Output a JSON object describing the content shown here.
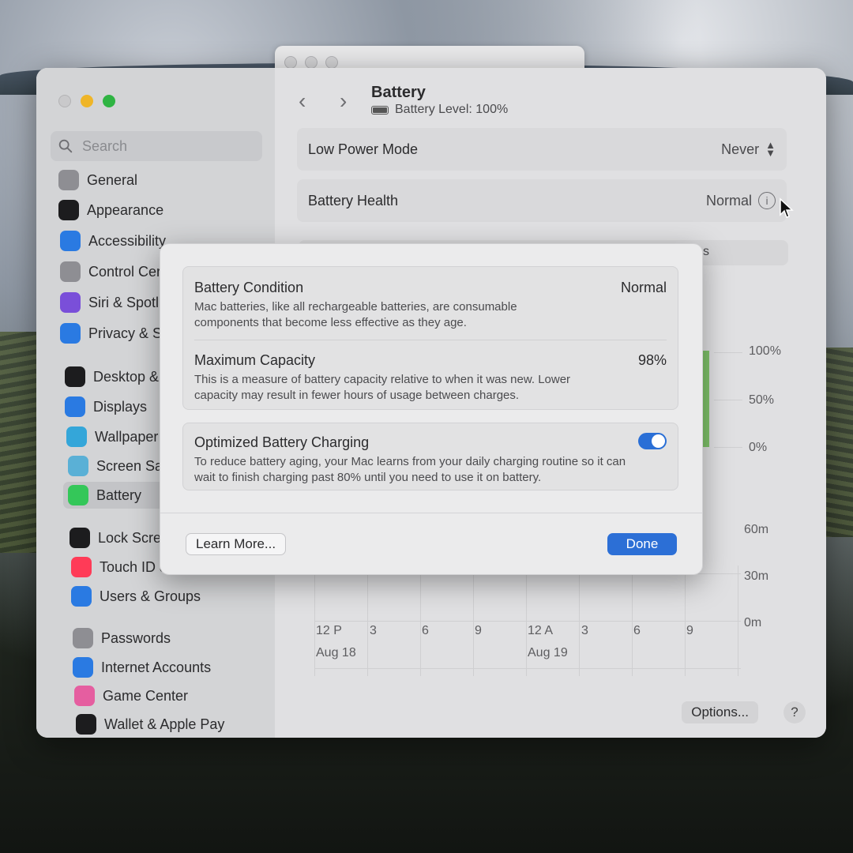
{
  "sidebar": {
    "search_placeholder": "Search",
    "items": [
      {
        "label": "General",
        "icon": "gear-icon",
        "color": "#8e8e93"
      },
      {
        "label": "Appearance",
        "icon": "appearance-icon",
        "color": "#1c1c1e"
      },
      {
        "label": "Accessibility",
        "icon": "accessibility-icon",
        "color": "#2a7ae2"
      },
      {
        "label": "Control Cer",
        "icon": "control-center-icon",
        "color": "#8e8e93"
      },
      {
        "label": "Siri & Spotl",
        "icon": "siri-icon",
        "color": "#7a4fd9"
      },
      {
        "label": "Privacy & S",
        "icon": "privacy-hand-icon",
        "color": "#2a7ae2"
      },
      {
        "label": "Desktop &",
        "icon": "desktop-dock-icon",
        "color": "#1c1c1e"
      },
      {
        "label": "Displays",
        "icon": "displays-icon",
        "color": "#2a7ae2"
      },
      {
        "label": "Wallpaper",
        "icon": "wallpaper-icon",
        "color": "#34a6d9"
      },
      {
        "label": "Screen Sav",
        "icon": "screen-saver-icon",
        "color": "#5ab0d6"
      },
      {
        "label": "Battery",
        "icon": "battery-icon",
        "color": "#34c759"
      },
      {
        "label": "Lock Scree",
        "icon": "lock-icon",
        "color": "#1c1c1e"
      },
      {
        "label": "Touch ID &",
        "icon": "fingerprint-icon",
        "color": "#ff3b57"
      },
      {
        "label": "Users & Groups",
        "icon": "users-icon",
        "color": "#2a7ae2"
      },
      {
        "label": "Passwords",
        "icon": "key-icon",
        "color": "#8e8e93"
      },
      {
        "label": "Internet Accounts",
        "icon": "at-sign-icon",
        "color": "#2a7ae2"
      },
      {
        "label": "Game Center",
        "icon": "game-center-icon",
        "color": "#e55ea0"
      },
      {
        "label": "Wallet & Apple Pay",
        "icon": "wallet-icon",
        "color": "#1c1c1e"
      }
    ]
  },
  "header": {
    "title": "Battery",
    "subtitle": "Battery Level: 100%"
  },
  "settings": {
    "low_power_label": "Low Power Mode",
    "low_power_value": "Never",
    "health_label": "Battery Health",
    "health_value": "Normal",
    "tab_fragment": "s"
  },
  "chart": {
    "level_ticks": [
      "100%",
      "50%",
      "0%"
    ],
    "usage_ticks": [
      "60m",
      "30m",
      "0m"
    ],
    "x_ticks": [
      "12 P",
      "3",
      "6",
      "9",
      "12 A",
      "3",
      "6",
      "9"
    ],
    "dates": [
      "Aug 18",
      "Aug 19"
    ]
  },
  "footer": {
    "options_label": "Options...",
    "help_label": "?"
  },
  "sheet": {
    "condition_title": "Battery Condition",
    "condition_value": "Normal",
    "condition_desc": "Mac batteries, like all rechargeable batteries, are consumable components that become less effective as they age.",
    "capacity_title": "Maximum Capacity",
    "capacity_value": "98%",
    "capacity_desc": "This is a measure of battery capacity relative to when it was new. Lower capacity may result in fewer hours of usage between charges.",
    "optimized_title": "Optimized Battery Charging",
    "optimized_desc": "To reduce battery aging, your Mac learns from your daily charging routine so it can wait to finish charging past 80% until you need to use it on battery.",
    "optimized_enabled": true,
    "learn_more_label": "Learn More...",
    "done_label": "Done"
  },
  "colors": {
    "accent": "#2c6fd6",
    "battery_green": "#7fc36a"
  }
}
